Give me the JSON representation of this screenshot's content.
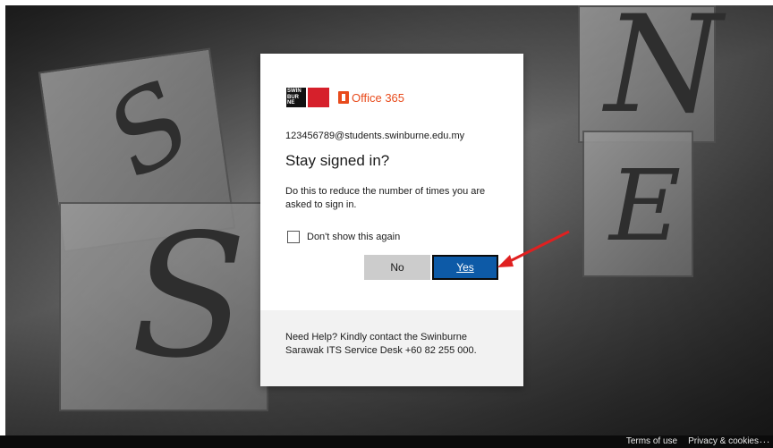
{
  "login": {
    "brand": {
      "university_logo": "SWIN BUR NE",
      "product": "Office 365"
    },
    "email": "123456789@students.swinburne.edu.my",
    "title": "Stay signed in?",
    "description": "Do this to reduce the number of times you are asked to sign in.",
    "dont_show_label": "Don't show this again",
    "dont_show_checked": false,
    "no_label": "No",
    "yes_label": "Yes",
    "help_text": "Need Help? Kindly contact the Swinburne Sarawak ITS Service Desk +60 82 255 000."
  },
  "footer": {
    "terms": "Terms of use",
    "privacy": "Privacy & cookies",
    "more": "..."
  },
  "colors": {
    "primary_button": "#0d5aa7",
    "secondary_button": "#cccccc",
    "office_orange": "#e84b1c",
    "annotation_arrow": "#e02020"
  }
}
